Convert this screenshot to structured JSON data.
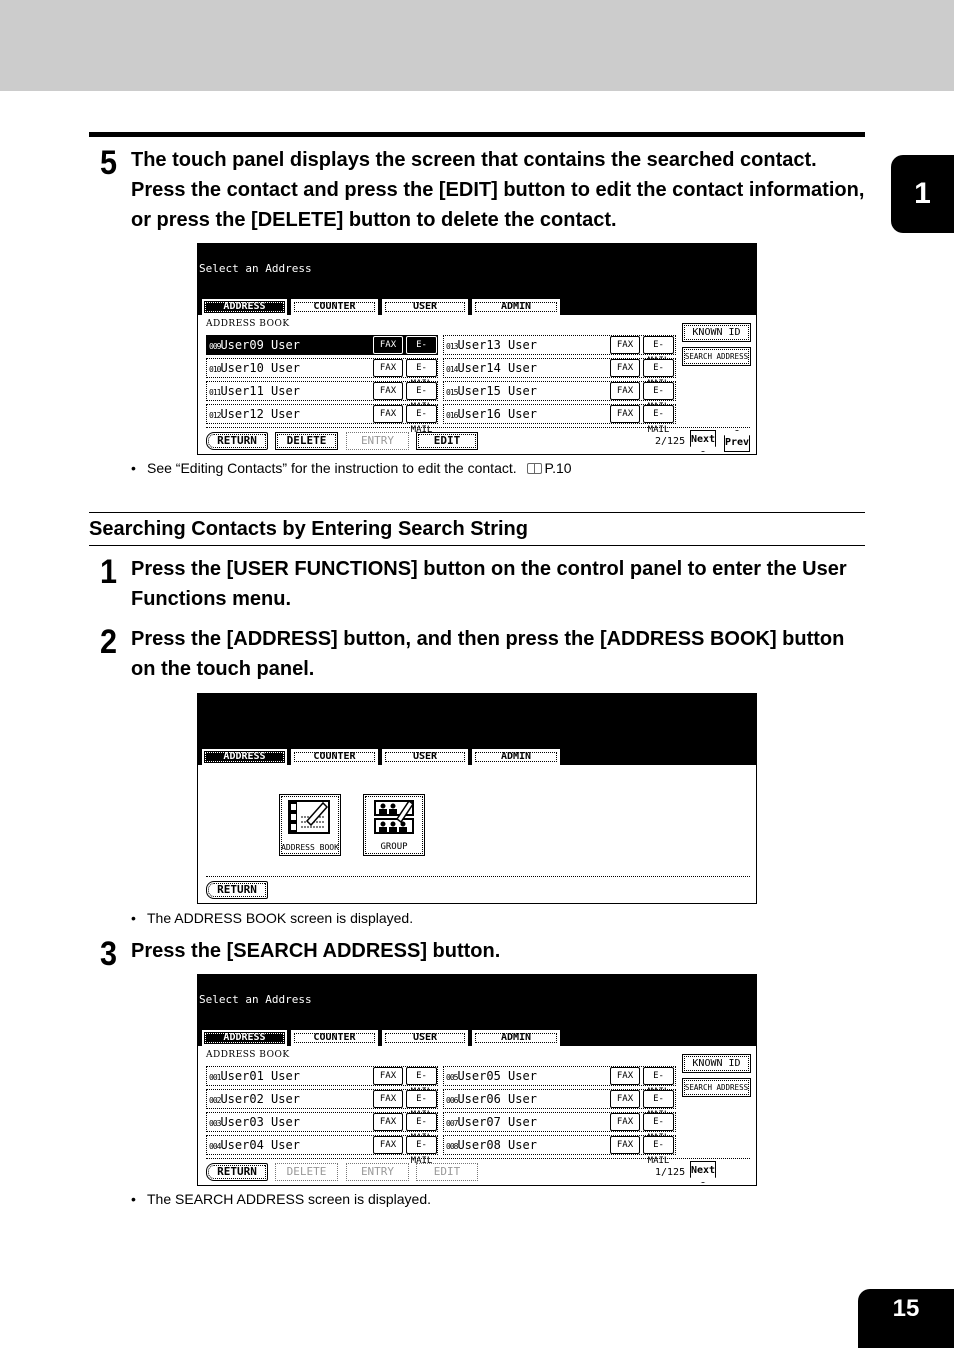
{
  "page": {
    "chapter_tab": "1",
    "page_number": "15",
    "colors": {
      "header_band": "#cccccc",
      "panel_bg": "#000000",
      "text": "#000000"
    }
  },
  "step5": {
    "number": "5",
    "text": "The touch panel displays the screen that contains the searched contact.  Press the contact and press the [EDIT] button to edit the contact information, or press the [DELETE] button to delete the contact.",
    "note": "See “Editing Contacts” for the instruction to edit the contact.",
    "note_ref": "P.10"
  },
  "section": {
    "title": "Searching Contacts by Entering Search String"
  },
  "step1": {
    "number": "1",
    "text": "Press the [USER FUNCTIONS] button on the control panel to enter the User Functions menu."
  },
  "step2": {
    "number": "2",
    "text": "Press the [ADDRESS] button, and then press the [ADDRESS BOOK] button on the touch panel.",
    "note": "The ADDRESS BOOK screen is displayed."
  },
  "step3": {
    "number": "3",
    "text": "Press the [SEARCH ADDRESS] button.",
    "note": "The SEARCH ADDRESS screen is displayed."
  },
  "tabs": [
    "ADDRESS",
    "COUNTER",
    "USER",
    "ADMIN"
  ],
  "panel_common": {
    "title": "Select an Address",
    "book_label": "ADDRESS BOOK",
    "fax": "FAX",
    "email": "E-MAIL",
    "known_id": "KNOWN ID",
    "search_address": "SEARCH ADDRESS",
    "return": "RETURN",
    "delete": "DELETE",
    "entry": "ENTRY",
    "edit": "EDIT",
    "next": "Next",
    "prev": "Prev"
  },
  "panel1": {
    "pager": "2/125",
    "left": [
      {
        "num": "009",
        "name": "User09 User",
        "selected": true
      },
      {
        "num": "010",
        "name": "User10 User"
      },
      {
        "num": "011",
        "name": "User11 User"
      },
      {
        "num": "012",
        "name": "User12 User"
      }
    ],
    "right": [
      {
        "num": "013",
        "name": "User13 User"
      },
      {
        "num": "014",
        "name": "User14 User"
      },
      {
        "num": "015",
        "name": "User15 User"
      },
      {
        "num": "016",
        "name": "User16 User"
      }
    ]
  },
  "panel2": {
    "address_book": "ADDRESS BOOK",
    "group": "GROUP"
  },
  "panel3": {
    "pager": "1/125",
    "left": [
      {
        "num": "001",
        "name": "User01 User"
      },
      {
        "num": "002",
        "name": "User02 User"
      },
      {
        "num": "003",
        "name": "User03 User"
      },
      {
        "num": "004",
        "name": "User04 User"
      }
    ],
    "right": [
      {
        "num": "005",
        "name": "User05 User"
      },
      {
        "num": "006",
        "name": "User06 User"
      },
      {
        "num": "007",
        "name": "User07 User"
      },
      {
        "num": "008",
        "name": "User08 User"
      }
    ]
  }
}
